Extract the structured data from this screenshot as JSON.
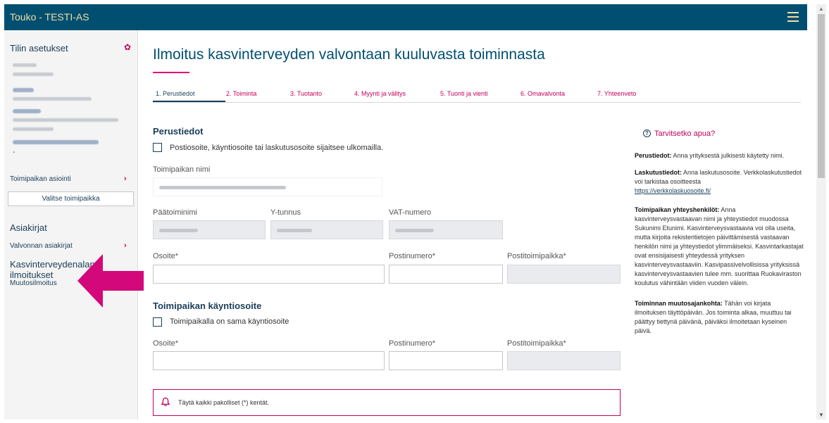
{
  "app": {
    "title": "Touko - TESTI-AS"
  },
  "sidebar": {
    "account_settings": "Tilin asetukset",
    "dash": "-",
    "site_matters": "Toimipaikan asiointi",
    "choose_site_button": "Valitse toimipaikka",
    "documents_heading": "Asiakirjat",
    "inspection_documents": "Valvonnan asiakirjat",
    "notifications_heading": "Kasvinterveydenalan ilmoitukset",
    "change_notification": "Muutosilmoitus"
  },
  "page": {
    "title": "Ilmoitus kasvinterveyden valvontaan kuuluvasta toiminnasta",
    "steps": [
      "1. Perustiedot",
      "2. Toiminta",
      "3. Tuotanto",
      "4. Myynti ja välitys",
      "5. Tuonti ja vienti",
      "6. Omavalvonta",
      "7. Yhteenveto"
    ]
  },
  "basic": {
    "heading": "Perustiedot",
    "abroad_checkbox": "Postiosoite, käyntiosoite tai laskutusosoite sijaitsee ulkomailla.",
    "site_name_label": "Toimipaikan nimi",
    "main_name_label": "Päätoiminimi",
    "business_id_label": "Y-tunnus",
    "vat_label": "VAT-numero",
    "address_label": "Osoite*",
    "postcode_label": "Postinumero*",
    "city_label": "Postitoimipaikka*"
  },
  "visit": {
    "heading": "Toimipaikan käyntiosoite",
    "same_address_checkbox": "Toimipaikalla on sama käyntiosoite",
    "address_label": "Osoite*",
    "postcode_label": "Postinumero*",
    "city_label": "Postitoimipaikka*"
  },
  "notice": {
    "message": "Täytä kaikki pakolliset (*) kentät."
  },
  "help": {
    "title": "Tarvitsetko apua?",
    "basic_term": "Perustiedot:",
    "basic_text": " Anna yrityksestä julkisesti käytetty nimi.",
    "billing_term": "Laskutustiedot:",
    "billing_text": " Anna laskutusosoite. Verkkolaskutustiedot voi tarkistaa osoitteesta",
    "billing_link": "https://verkkolaskuosoite.fi/",
    "contacts_term": "Toimipaikan yhteyshenkilöt:",
    "contacts_text": " Anna kasvinterveysvastaavan nimi ja yhteystiedot muodossa Sukunimi Etunimi. Kasvinterveysvastaavia voi olla useita, mutta kirjoita rekisteritietojen päivittämisestä vastaavan henkilön nimi ja yhteystiedot ylimmäiseksi. Kasvintarkastajat ovat ensisijaisesti yhteydessä yrityksen kasvinterveysvastaaviin. Kasvipassivelvollisissa yrityksissä kasvinterveysvastaavien tulee mm. suorittaa Ruokaviraston koulutus vähintään viiden vuoden välein.",
    "change_term": "Toiminnan muutosajankohta:",
    "change_text": " Tähän voi kirjata ilmoituksen täyttöpäivän. Jos toiminta alkaa, muuttuu tai päättyy tiettynä päivänä, päiväksi ilmoitetaan kyseinen päivä."
  },
  "colors": {
    "header": "#004f71",
    "accent": "#c3005c",
    "title": "#004f71"
  }
}
